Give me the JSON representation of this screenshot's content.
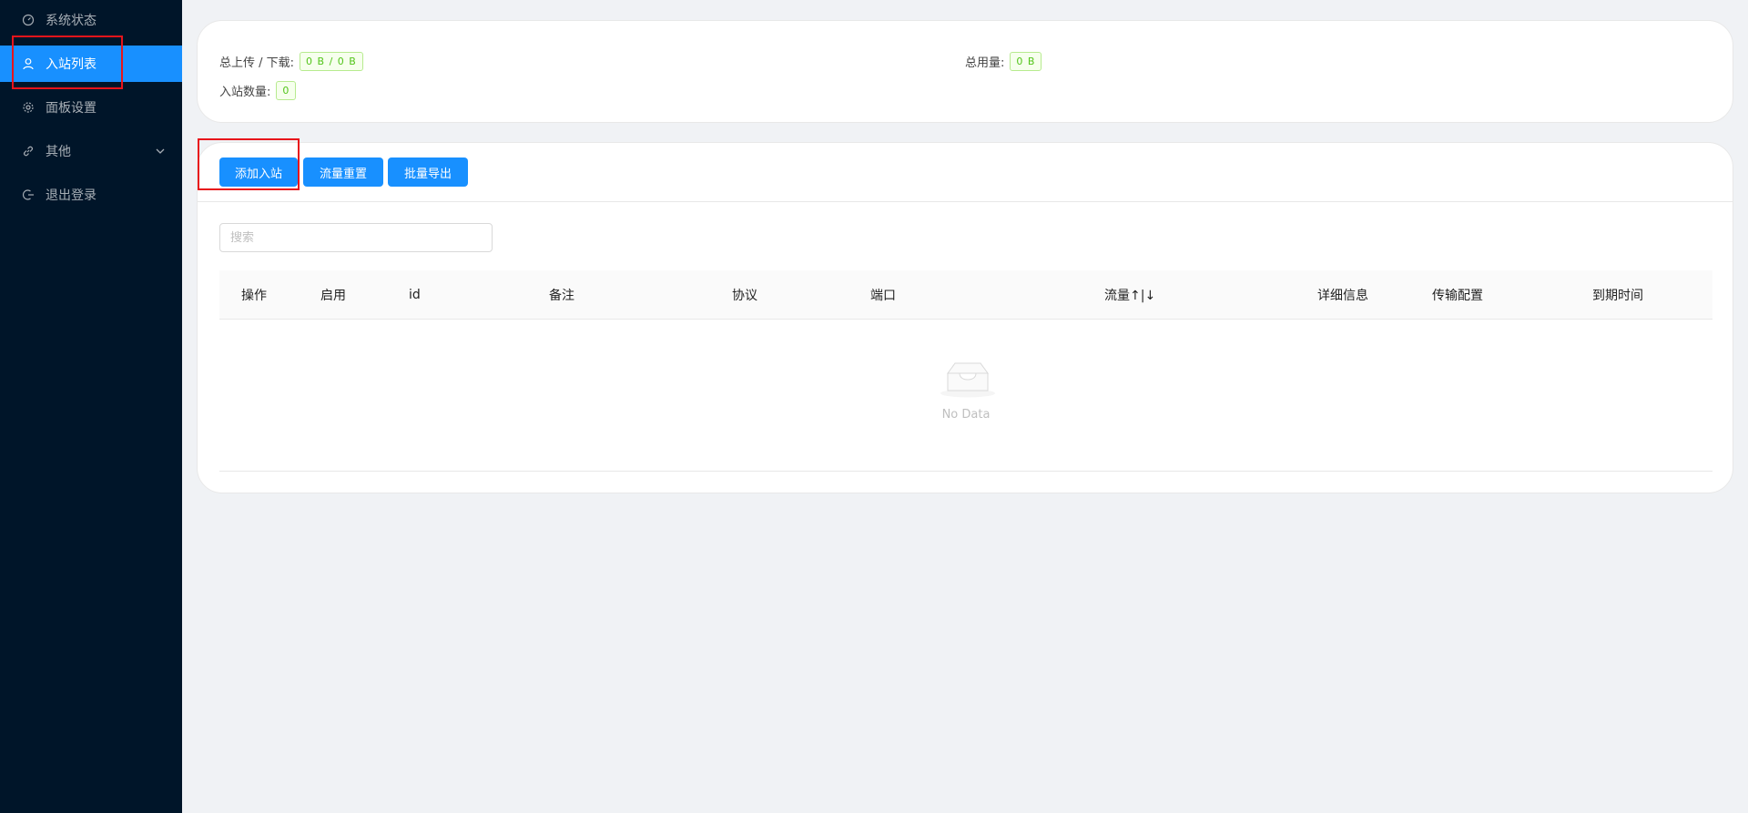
{
  "sidebar": {
    "items": [
      {
        "label": "系统状态",
        "icon": "dashboard-icon",
        "active": false
      },
      {
        "label": "入站列表",
        "icon": "user-icon",
        "active": true
      },
      {
        "label": "面板设置",
        "icon": "gear-icon",
        "active": false
      },
      {
        "label": "其他",
        "icon": "link-icon",
        "active": false,
        "has_submenu": true
      },
      {
        "label": "退出登录",
        "icon": "logout-icon",
        "active": false
      }
    ]
  },
  "stats": {
    "upload_download_label": "总上传 / 下载:",
    "upload_download_value": "0 B / 0 B",
    "total_usage_label": "总用量:",
    "total_usage_value": "0 B",
    "inbound_count_label": "入站数量:",
    "inbound_count_value": "0"
  },
  "toolbar": {
    "add_inbound": "添加入站",
    "reset_traffic": "流量重置",
    "batch_export": "批量导出"
  },
  "search": {
    "placeholder": "搜索"
  },
  "table": {
    "columns": [
      "操作",
      "启用",
      "id",
      "备注",
      "协议",
      "端口",
      "流量↑|↓",
      "详细信息",
      "传输配置",
      "到期时间"
    ],
    "rows": [],
    "empty_text": "No Data"
  },
  "colors": {
    "sidebar_bg": "#001529",
    "accent": "#1890ff",
    "tag_green": "#52c41a",
    "highlight": "#e8141b"
  }
}
